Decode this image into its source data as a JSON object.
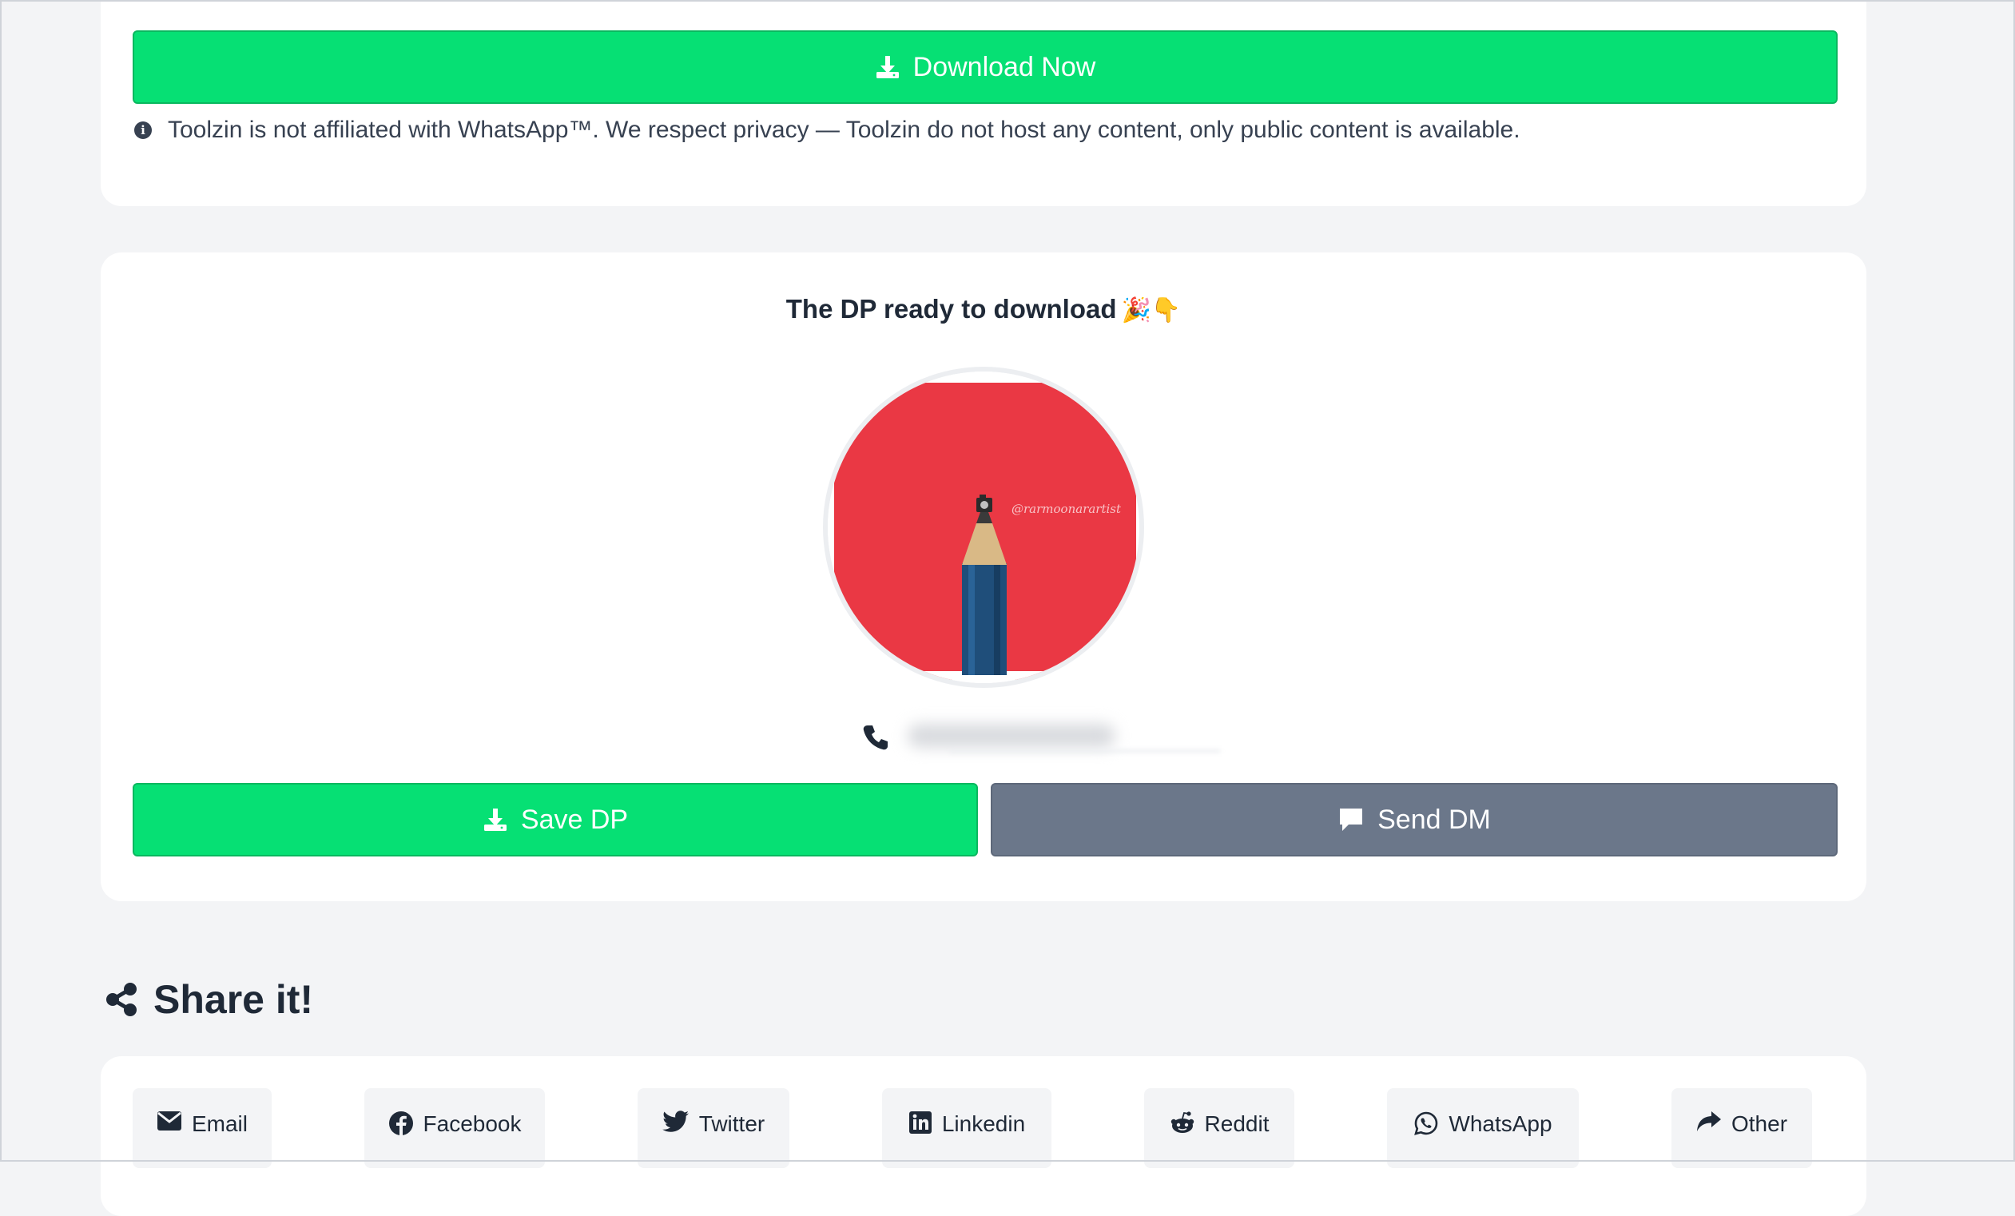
{
  "top_card": {
    "download_button_label": "Download Now",
    "disclaimer": "Toolzin is not affiliated with WhatsApp™. We respect privacy — Toolzin do not host any content, only public content is available."
  },
  "dp_card": {
    "heading": "The DP ready to download",
    "heading_emoji": "🎉👇",
    "image_watermark": "@rarmoonarartist",
    "save_button_label": "Save DP",
    "send_button_label": "Send DM"
  },
  "share": {
    "title": "Share it!",
    "items": [
      {
        "label": "Email",
        "icon": "envelope-icon"
      },
      {
        "label": "Facebook",
        "icon": "facebook-icon"
      },
      {
        "label": "Twitter",
        "icon": "twitter-icon"
      },
      {
        "label": "Linkedin",
        "icon": "linkedin-icon"
      },
      {
        "label": "Reddit",
        "icon": "reddit-icon"
      },
      {
        "label": "WhatsApp",
        "icon": "whatsapp-icon"
      },
      {
        "label": "Other",
        "icon": "share-arrow-icon"
      }
    ]
  },
  "colors": {
    "page_background": "#f3f4f6",
    "primary_green": "#06e074",
    "secondary_gray": "#6b778a",
    "text_dark": "#1f2937"
  }
}
